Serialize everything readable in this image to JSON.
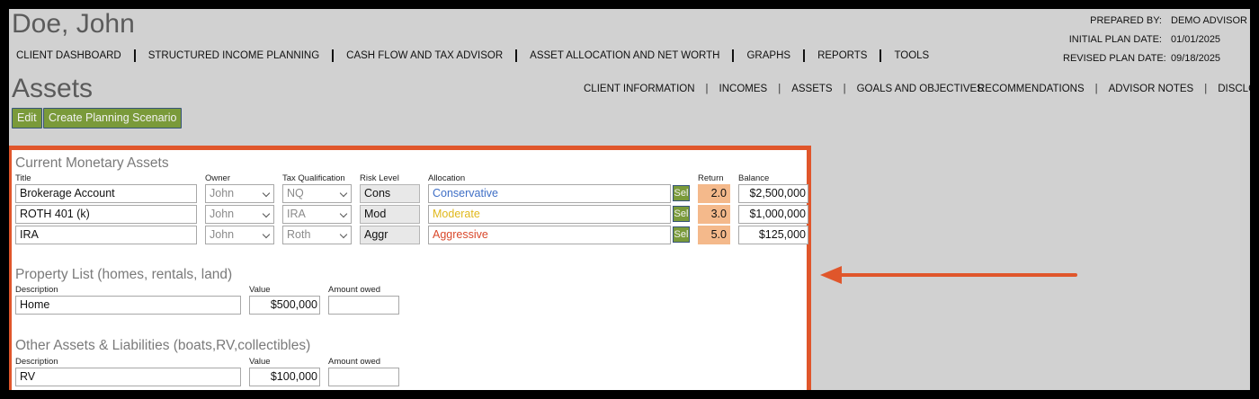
{
  "client_name": "Doe, John",
  "prepared": [
    {
      "label": "PREPARED BY:",
      "value": "DEMO ADVISOR"
    },
    {
      "label": "INITIAL PLAN DATE:",
      "value": "01/01/2025"
    },
    {
      "label": "REVISED PLAN DATE:",
      "value": "09/18/2025"
    }
  ],
  "main_nav": [
    "CLIENT DASHBOARD",
    "STRUCTURED INCOME PLANNING",
    "CASH FLOW AND TAX ADVISOR",
    "ASSET ALLOCATION AND NET WORTH",
    "GRAPHS",
    "REPORTS",
    "TOOLS"
  ],
  "page_title": "Assets",
  "sub_nav": [
    "CLIENT INFORMATION",
    "INCOMES",
    "ASSETS",
    "GOALS AND OBJECTIVES",
    "RECOMMENDATIONS",
    "ADVISOR NOTES",
    "DISCLOSURE"
  ],
  "buttons": {
    "edit": "Edit",
    "scenario": "Create Planning Scenario"
  },
  "monetary": {
    "title": "Current Monetary Assets",
    "headers": {
      "title": "Title",
      "owner": "Owner",
      "tax": "Tax Qualification",
      "risk": "Risk Level",
      "allocation": "Allocation",
      "return": "Return",
      "balance": "Balance"
    },
    "sel_label": "Sel",
    "rows": [
      {
        "title": "Brokerage Account",
        "owner": "John",
        "tax": "NQ",
        "risk": "Cons",
        "allocation": "Conservative",
        "alloc_color": "#3f6fc6",
        "return": "2.0",
        "balance": "$2,500,000"
      },
      {
        "title": "ROTH 401 (k)",
        "owner": "John",
        "tax": "IRA",
        "risk": "Mod",
        "allocation": "Moderate",
        "alloc_color": "#e0b81c",
        "return": "3.0",
        "balance": "$1,000,000"
      },
      {
        "title": "IRA",
        "owner": "John",
        "tax": "Roth",
        "risk": "Aggr",
        "allocation": "Aggressive",
        "alloc_color": "#d9482b",
        "return": "5.0",
        "balance": "$125,000"
      }
    ]
  },
  "property": {
    "title": "Property List (homes, rentals, land)",
    "headers": {
      "description": "Description",
      "value": "Value",
      "owed": "Amount owed"
    },
    "rows": [
      {
        "description": "Home",
        "value": "$500,000",
        "owed": ""
      }
    ]
  },
  "other": {
    "title": "Other Assets & Liabilities (boats,RV,collectibles)",
    "headers": {
      "description": "Description",
      "value": "Value",
      "owed": "Amount owed"
    },
    "rows": [
      {
        "description": "RV",
        "value": "$100,000",
        "owed": ""
      }
    ]
  },
  "colors": {
    "accent_button": "#7a9a3a",
    "highlight_border": "#e0562b",
    "return_bg": "#f4b98b",
    "page_bg": "#d1d1d1"
  }
}
